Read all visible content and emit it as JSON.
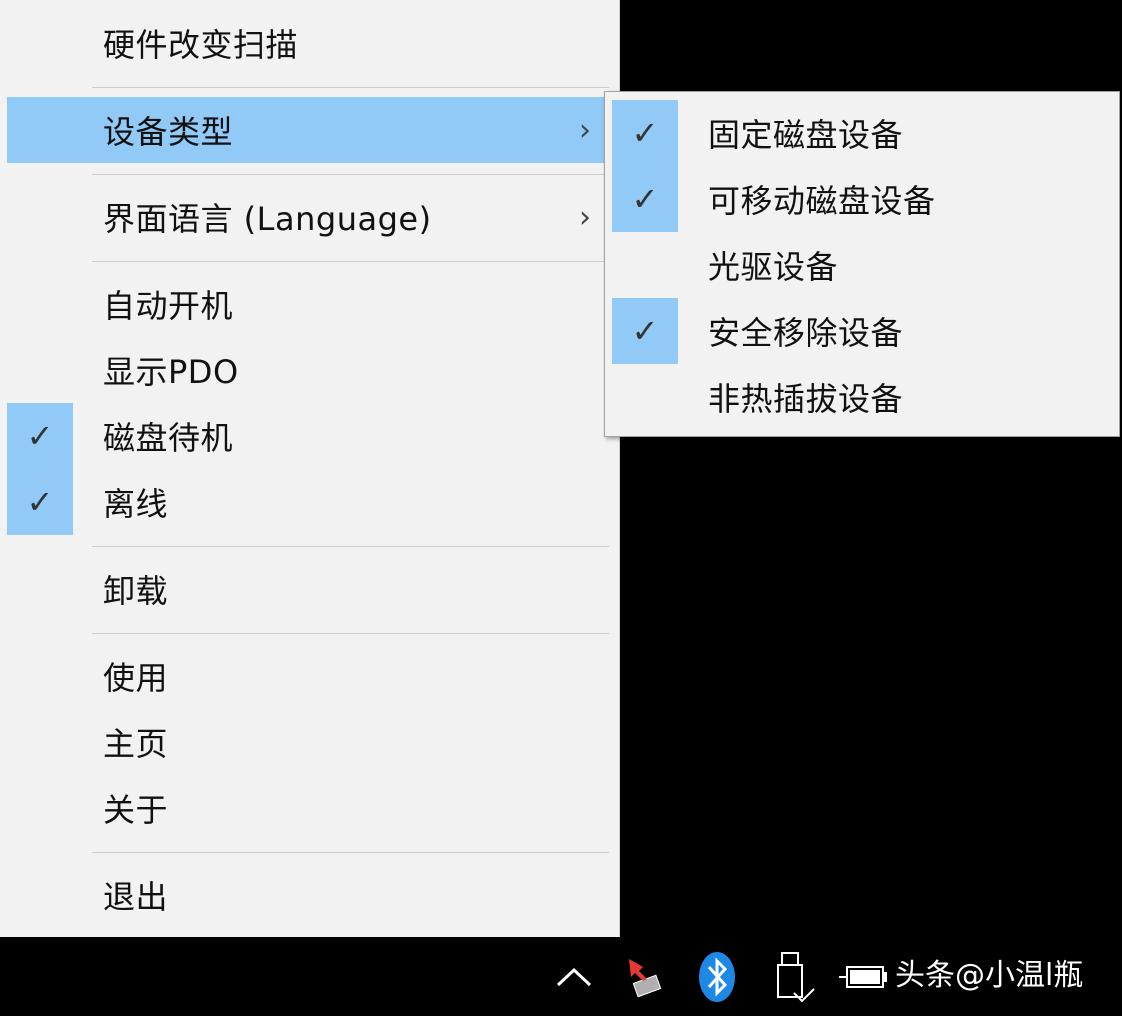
{
  "main_menu": {
    "items": [
      {
        "label": "硬件改变扫描",
        "checked": false,
        "submenu": false
      },
      {
        "label": "设备类型",
        "checked": false,
        "submenu": true,
        "highlighted": true
      },
      {
        "label": "界面语言 (Language)",
        "checked": false,
        "submenu": true
      },
      {
        "label": "自动开机",
        "checked": false,
        "submenu": false
      },
      {
        "label": "显示PDO",
        "checked": false,
        "submenu": false
      },
      {
        "label": "磁盘待机",
        "checked": true,
        "submenu": false
      },
      {
        "label": "离线",
        "checked": true,
        "submenu": false
      },
      {
        "label": "卸载",
        "checked": false,
        "submenu": false
      },
      {
        "label": "使用",
        "checked": false,
        "submenu": false
      },
      {
        "label": "主页",
        "checked": false,
        "submenu": false
      },
      {
        "label": "关于",
        "checked": false,
        "submenu": false
      },
      {
        "label": "退出",
        "checked": false,
        "submenu": false
      }
    ],
    "arrow_glyph": "›",
    "check_glyph": "✓"
  },
  "sub_menu": {
    "items": [
      {
        "label": "固定磁盘设备",
        "checked": true
      },
      {
        "label": "可移动磁盘设备",
        "checked": true
      },
      {
        "label": "光驱设备",
        "checked": false
      },
      {
        "label": "安全移除设备",
        "checked": true
      },
      {
        "label": "非热插拔设备",
        "checked": false
      }
    ]
  },
  "taskbar": {
    "icons": [
      "chevron-up-icon",
      "hardware-tray-icon",
      "bluetooth-icon",
      "usb-drive-icon",
      "battery-icon"
    ],
    "watermark": "头条@小温l瓶"
  },
  "colors": {
    "highlight": "#91c9f7",
    "menu_bg": "#f2f2f2",
    "separator": "#cdcdcd",
    "bluetooth": "#1e88e5",
    "taskbar_bg": "#000000"
  }
}
